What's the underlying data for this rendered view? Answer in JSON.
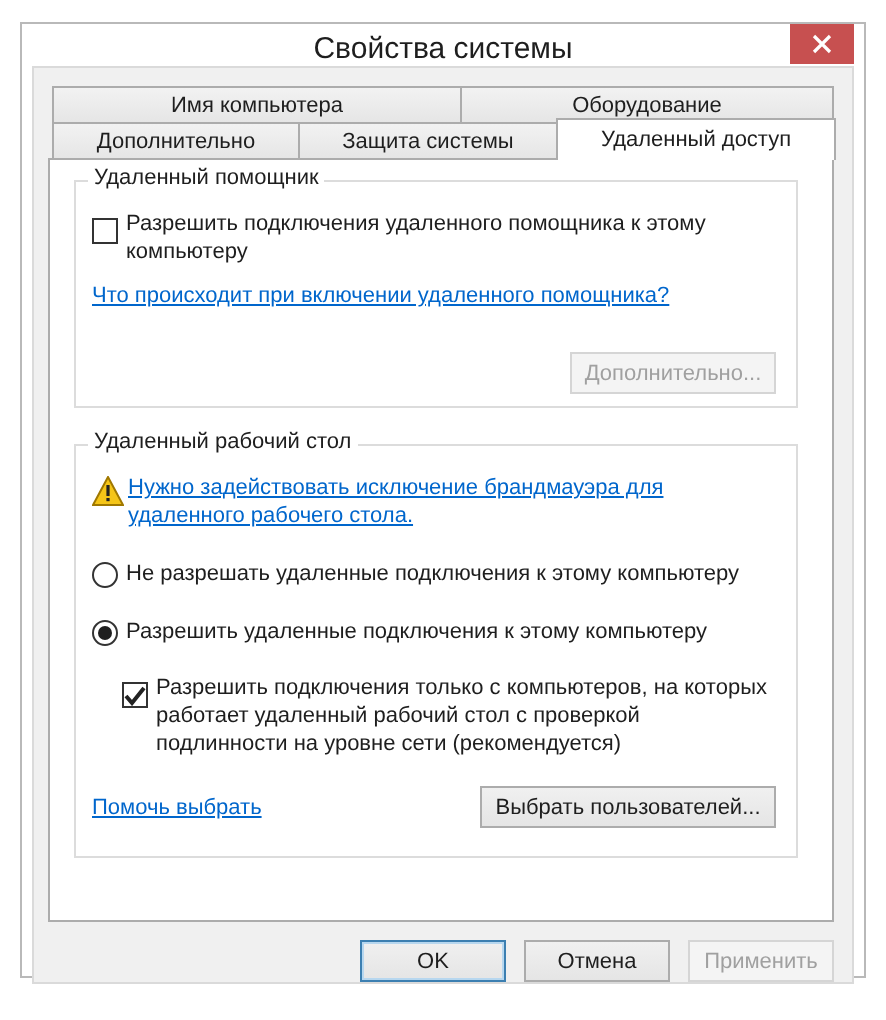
{
  "window": {
    "title": "Свойства системы"
  },
  "tab_rows": [
    [
      {
        "label": "Имя компьютера",
        "selected": false
      },
      {
        "label": "Оборудование",
        "selected": false
      }
    ],
    [
      {
        "label": "Дополнительно",
        "selected": false
      },
      {
        "label": "Защита системы",
        "selected": false
      },
      {
        "label": "Удаленный доступ",
        "selected": true
      }
    ]
  ],
  "remote_assistance": {
    "title": "Удаленный помощник",
    "checkbox": {
      "label": "Разрешить подключения удаленного помощника к этому компьютеру",
      "checked": false
    },
    "link": "Что происходит при включении удаленного помощника?",
    "button": {
      "label": "Дополнительно...",
      "disabled": true
    }
  },
  "remote_desktop": {
    "title": "Удаленный рабочий стол",
    "warning_link": "Нужно задействовать исключение брандмауэра для удаленного рабочего стола.",
    "options": [
      {
        "label": "Не разрешать удаленные подключения к этому компьютеру",
        "selected": false
      },
      {
        "label": "Разрешить удаленные подключения к этому компьютеру",
        "selected": true
      }
    ],
    "nla_checkbox": {
      "label": "Разрешить подключения только с компьютеров, на которых работает удаленный рабочий стол с проверкой подлинности на уровне сети (рекомендуется)",
      "checked": true
    },
    "help_link": "Помочь выбрать",
    "users_button": {
      "label": "Выбрать пользователей...",
      "disabled": false
    }
  },
  "buttons": [
    {
      "label": "OK",
      "default": true,
      "disabled": false
    },
    {
      "label": "Отмена",
      "default": false,
      "disabled": false
    },
    {
      "label": "Применить",
      "default": false,
      "disabled": true
    }
  ]
}
